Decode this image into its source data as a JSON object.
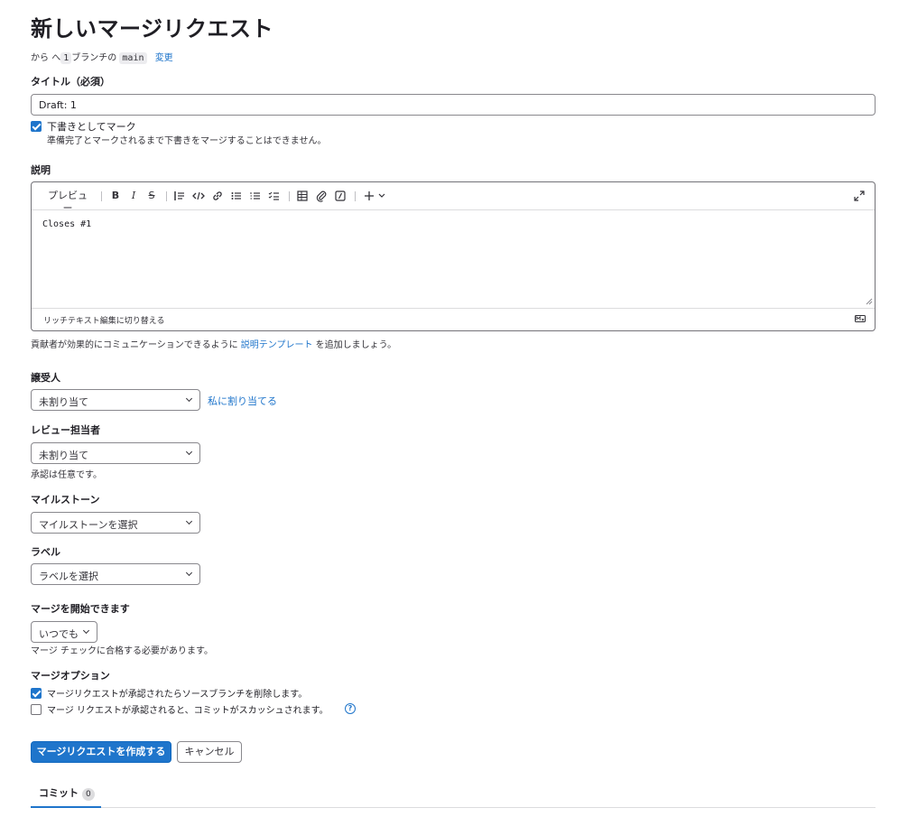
{
  "page": {
    "title": "新しいマージリクエスト",
    "branch_info": {
      "from": "から",
      "to_prefix": "へ",
      "source": "1",
      "to_mid": "ブランチの",
      "target": "main",
      "change_link": "変更"
    }
  },
  "title_field": {
    "label": "タイトル（必須）",
    "value": "Draft: 1",
    "draft_checkbox": {
      "label": "下書きとしてマーク",
      "help": "準備完了とマークされるまで下書きをマージすることはできません。",
      "checked": true
    }
  },
  "description": {
    "label": "説明",
    "preview_tab": "プレビュー",
    "content": "Closes #1",
    "switch_rich_text": "リッチテキスト編集に切り替える",
    "hint_before": "貢献者が効果的にコミュニケーションできるように ",
    "hint_link": "説明テンプレート",
    "hint_after": " を追加しましょう。"
  },
  "assignee": {
    "label": "譲受人",
    "value": "未割り当て",
    "assign_me": "私に割り当てる"
  },
  "reviewer": {
    "label": "レビュー担当者",
    "value": "未割り当て",
    "help": "承認は任意です。"
  },
  "milestone": {
    "label": "マイルストーン",
    "value": "マイルストーンを選択"
  },
  "labels": {
    "label": "ラベル",
    "value": "ラベルを選択"
  },
  "merge_start": {
    "label": "マージを開始できます",
    "value": "いつでも",
    "help": "マージ チェックに合格する必要があります。"
  },
  "merge_options": {
    "label": "マージオプション",
    "delete_branch": {
      "label": "マージリクエストが承認されたらソースブランチを削除します。",
      "checked": true
    },
    "squash": {
      "label": "マージ リクエストが承認されると、コミットがスカッシュされます。",
      "checked": false
    }
  },
  "actions": {
    "create": "マージリクエストを作成する",
    "cancel": "キャンセル"
  },
  "tabs": {
    "commits_label": "コミット",
    "commits_count": "0"
  },
  "colors": {
    "primary": "#1f75cb",
    "border": "#89888d",
    "text": "#333238"
  }
}
